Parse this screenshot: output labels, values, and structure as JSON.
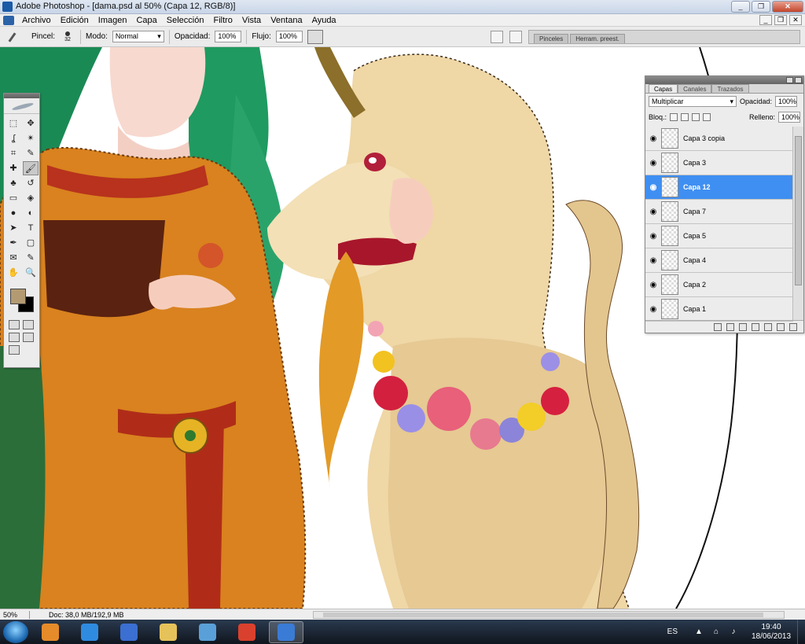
{
  "window": {
    "title": "Adobe Photoshop - [dama.psd al 50% (Capa 12, RGB/8)]",
    "controls": {
      "minimize": "_",
      "maximize": "❐",
      "close": "✕"
    }
  },
  "menubar": {
    "items": [
      "Archivo",
      "Edición",
      "Imagen",
      "Capa",
      "Selección",
      "Filtro",
      "Vista",
      "Ventana",
      "Ayuda"
    ],
    "doc_controls": {
      "minimize": "_",
      "restore": "❐",
      "close": "✕"
    }
  },
  "options": {
    "brush_label": "Pincel:",
    "brush_size": "32",
    "mode_label": "Modo:",
    "mode_value": "Normal",
    "opacity_label": "Opacidad:",
    "opacity_value": "100%",
    "flow_label": "Flujo:",
    "flow_value": "100%",
    "well_tabs": [
      "Pinceles",
      "Herram. preest."
    ]
  },
  "tools": {
    "foreground_color": "#b39a72",
    "background_color": "#000000",
    "items": [
      "marquee-icon",
      "move-icon",
      "lasso-icon",
      "magic-wand-icon",
      "crop-icon",
      "eyedropper-icon",
      "healing-icon",
      "brush-icon",
      "clone-icon",
      "history-brush-icon",
      "eraser-icon",
      "bucket-icon",
      "blur-icon",
      "dodge-icon",
      "path-select-icon",
      "type-icon",
      "pen-icon",
      "shape-icon",
      "notes-icon",
      "eyedropper2-icon",
      "hand-icon",
      "zoom-icon"
    ],
    "glyphs": [
      "⬚",
      "✥",
      "ʆ",
      "✴",
      "⌗",
      "✎",
      "✚",
      "🖌",
      "♣",
      "↺",
      "▭",
      "◈",
      "●",
      "◐",
      "➤",
      "T",
      "✒",
      "▢",
      "✉",
      "✎",
      "✋",
      "🔍"
    ],
    "active_index": 7
  },
  "layers": {
    "tabs": [
      "Capas",
      "Canales",
      "Trazados"
    ],
    "active_tab": "Capas",
    "blend_mode": "Multiplicar",
    "opacity_label": "Opacidad:",
    "opacity_value": "100%",
    "lock_label": "Bloq.:",
    "fill_label": "Relleno:",
    "fill_value": "100%",
    "items": [
      {
        "name": "Capa 3 copia",
        "selected": false
      },
      {
        "name": "Capa 3",
        "selected": false
      },
      {
        "name": "Capa 12",
        "selected": true
      },
      {
        "name": "Capa 7",
        "selected": false
      },
      {
        "name": "Capa 5",
        "selected": false
      },
      {
        "name": "Capa 4",
        "selected": false
      },
      {
        "name": "Capa 2",
        "selected": false
      },
      {
        "name": "Capa 1",
        "selected": false
      }
    ]
  },
  "status": {
    "zoom": "50%",
    "doc": "Doc: 38,0 MB/192,9 MB"
  },
  "taskbar": {
    "apps": [
      "media-player-icon",
      "internet-explorer-icon",
      "photo-app-icon",
      "explorer-folder-icon",
      "network-app-icon",
      "chrome-icon",
      "photoshop-icon"
    ],
    "app_colors": [
      "#e58b2a",
      "#2f8be0",
      "#3b6fd1",
      "#e6c25a",
      "#5aa0d8",
      "#d9412e",
      "#3a7bd5"
    ],
    "active_index": 6,
    "language": "ES",
    "time": "19:40",
    "date": "18/06/2013"
  }
}
